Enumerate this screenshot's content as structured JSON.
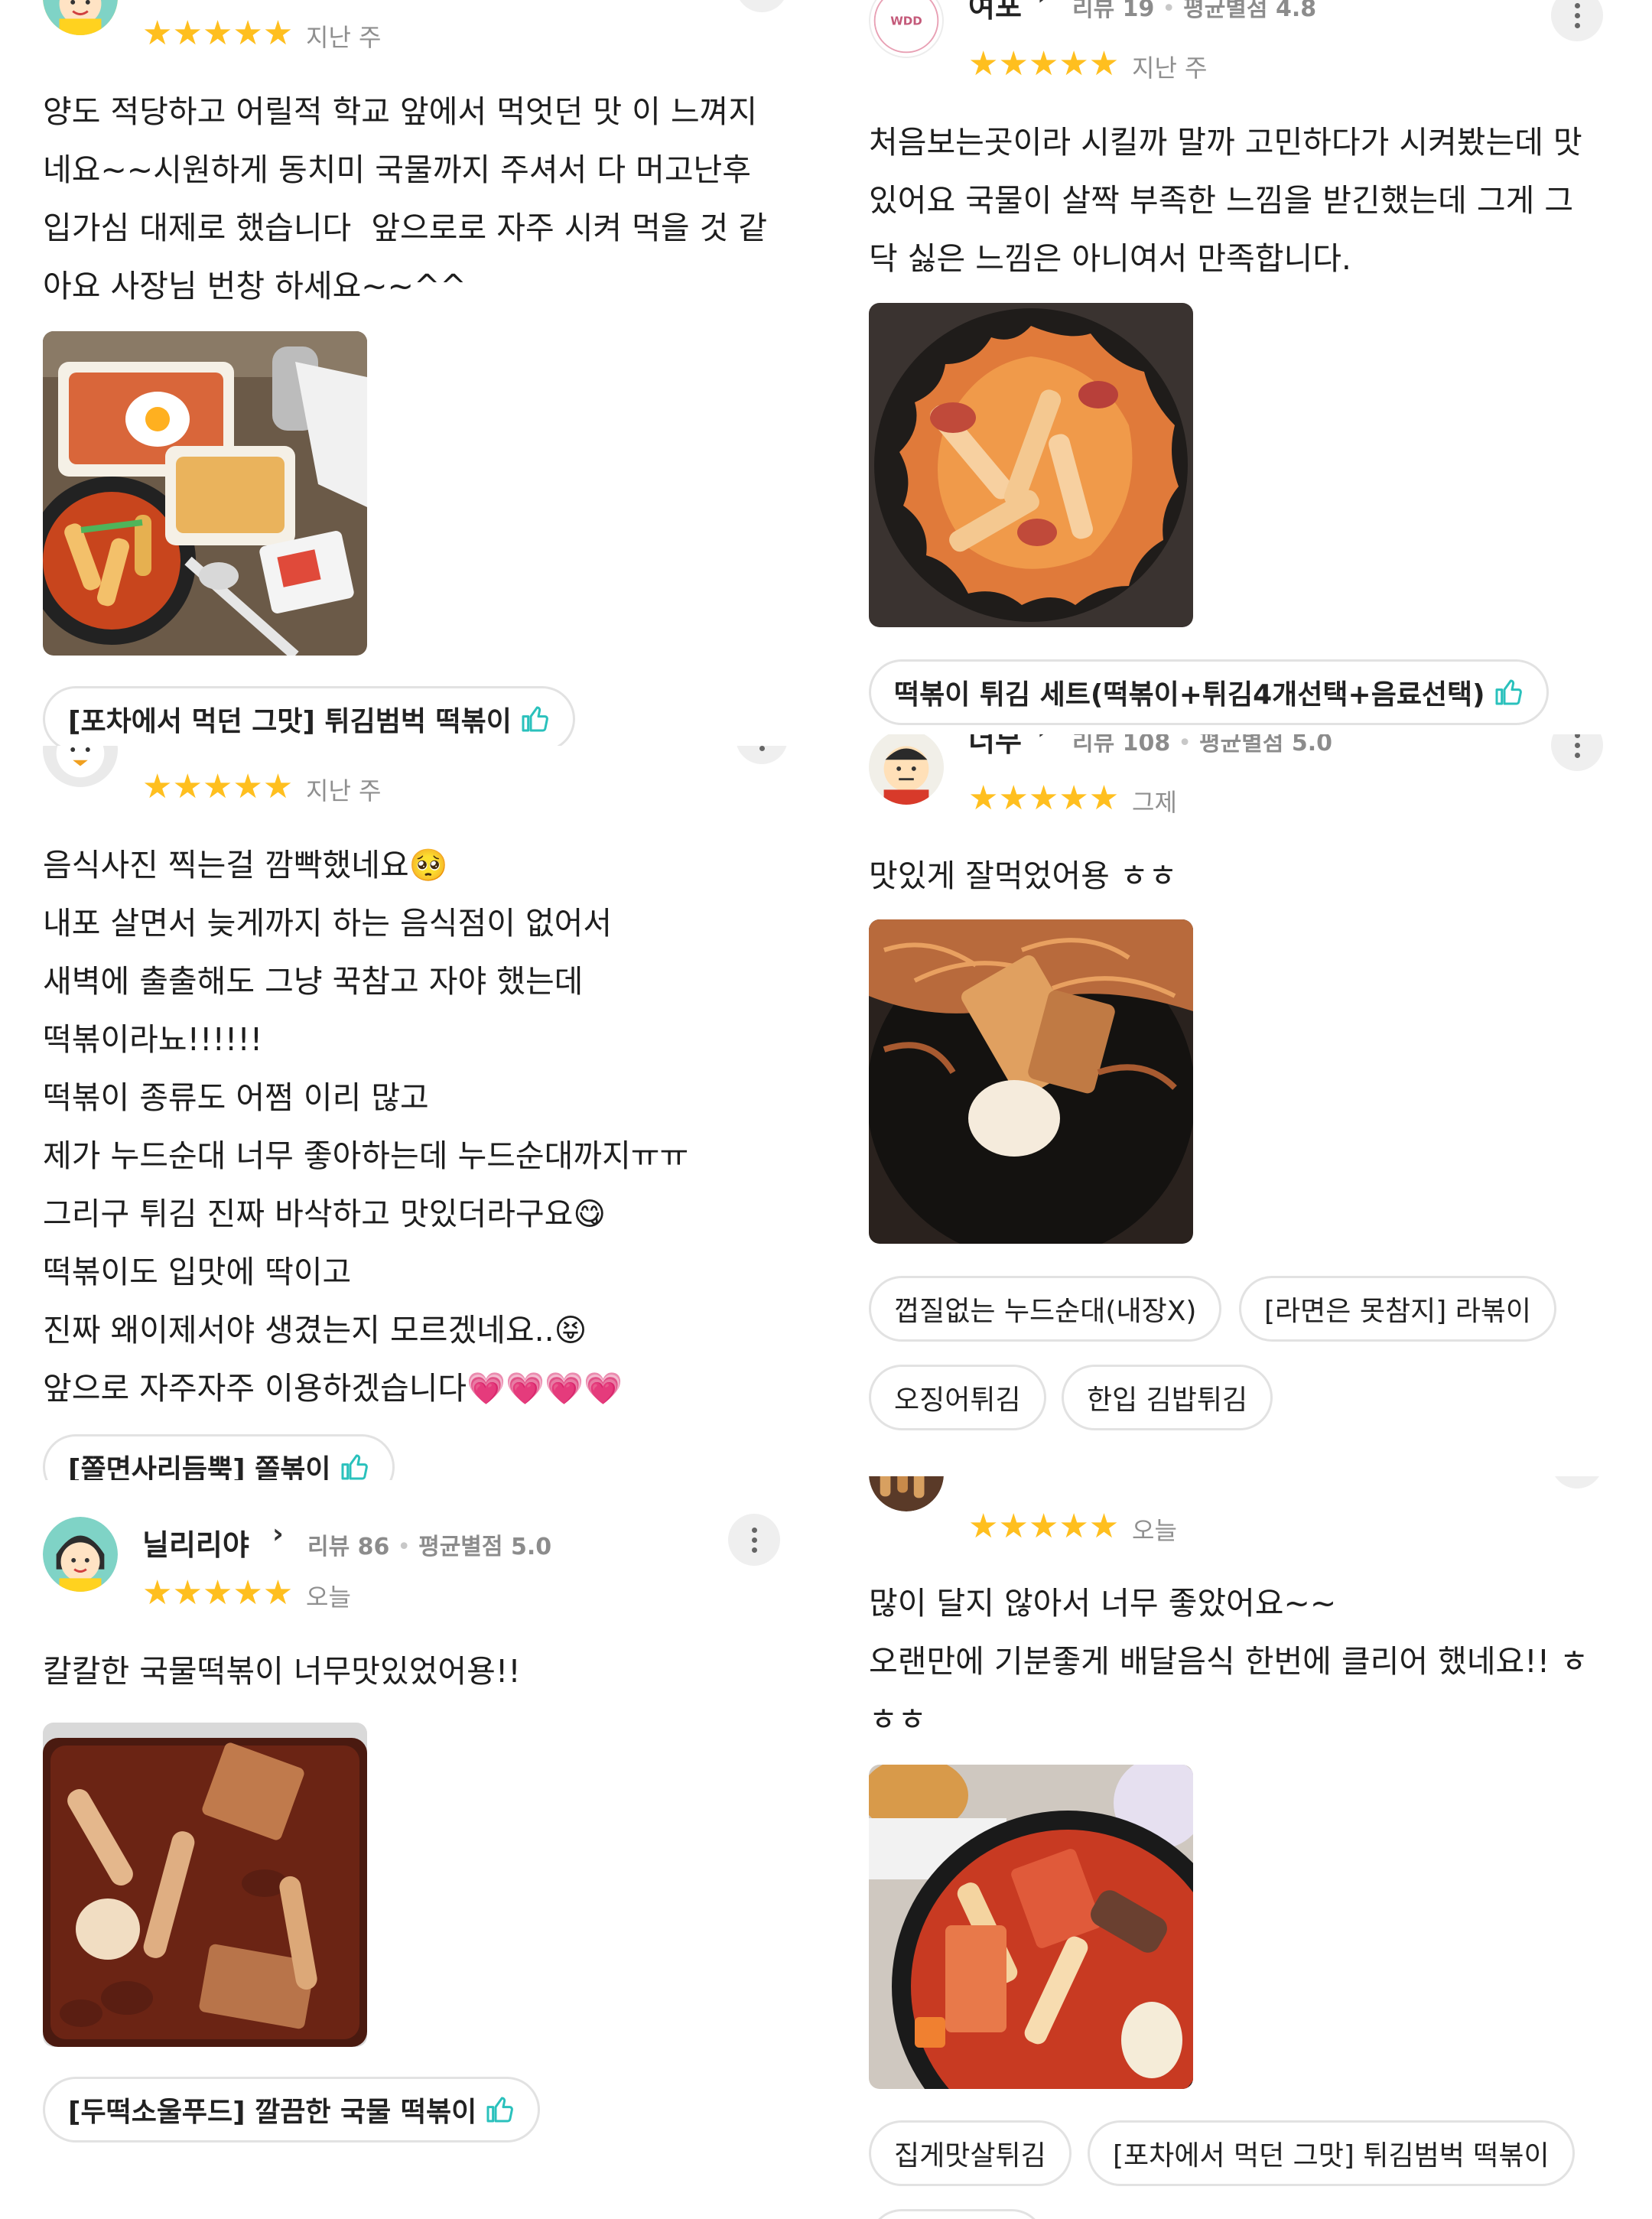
{
  "colors": {
    "star": "#ffbf1f",
    "thumb_icon": "#2ac1bc",
    "chip_border": "#e2e2e2",
    "meta": "#9a9a9a"
  },
  "icons": {
    "more": "more-vertical-icon",
    "thumb": "thumbs-up-icon",
    "chevron": "chevron-right-icon"
  },
  "stars_glyph": "★★★★★",
  "chevron_glyph": "›",
  "reviews": [
    {
      "when": "지난 주",
      "text": "양도 적당하고 어릴적 학교 앞에서 먹엇던 맛 이 느껴지\n네요~~시원하게 동치미 국물까지 주셔서 다 머고난후\n입가심 대제로 했습니다  앞으로로 자주 시켜 먹을 것 같\n아요 사장님 번창 하세요~~^^",
      "menu": [
        "[포차에서 먹던 그맛] 튀김범벅 떡볶이"
      ]
    },
    {
      "name": "여포",
      "logo_text": "WDD",
      "review_count_label": "리뷰 19",
      "avg_label": "평균별점 4.8",
      "when": "지난 주",
      "text": "처음보는곳이라 시킬까 말까 고민하다가 시켜봤는데 맛\n있어요 국물이 살짝 부족한 느낌을 받긴했는데 그게 그\n닥 싫은 느낌은 아니여서 만족합니다.",
      "menu": [
        "떡볶이 튀김 세트(떡볶이+튀김4개선택+음료선택)"
      ]
    },
    {
      "when": "지난 주",
      "text": "음식사진 찍는걸 깜빡했네요🥺\n내포 살면서 늦게까지 하는 음식점이 없어서\n새벽에 출출해도 그냥 꾹참고 자야 했는데\n떡볶이라뇨!!!!!!\n떡볶이 종류도 어쩜 이리 많고\n제가 누드순대 너무 좋아하는데 누드순대까지ㅠㅠ\n그리구 튀김 진짜 바삭하고 맛있더라구요😋\n떡볶이도 입맛에 딱이고\n진짜 왜이제서야 생겼는지 모르겠네요..😝\n앞으로 자주자주 이용하겠습니다💗💗💗💗",
      "menu": [
        "[쫄면사리듬뿍] 쫄볶이"
      ]
    },
    {
      "name": "너무",
      "review_count_label": "리뷰 108",
      "avg_label": "평균별점 5.0",
      "when": "그제",
      "text": "맛있게 잘먹었어용 ㅎㅎ",
      "menu": [
        "껍질없는 누드순대(내장X)",
        "[라면은 못참지] 라볶이",
        "오징어튀김",
        "한입 김밥튀김"
      ]
    },
    {
      "name": "닐리리야",
      "review_count_label": "리뷰 86",
      "avg_label": "평균별점 5.0",
      "when": "오늘",
      "text": "칼칼한 국물떡볶이 너무맛있었어용!!",
      "menu": [
        "[두떡소울푸드] 깔끔한 국물 떡볶이"
      ]
    },
    {
      "when": "오늘",
      "text": "많이 달지 않아서 너무 좋았어요~~\n오랜만에 기분좋게 배달음식 한번에 클리어 했네요!! ㅎ\nㅎㅎ",
      "menu": [
        "집게맛살튀김",
        "[포차에서 먹던 그맛] 튀김범벅 떡볶이"
      ]
    }
  ]
}
